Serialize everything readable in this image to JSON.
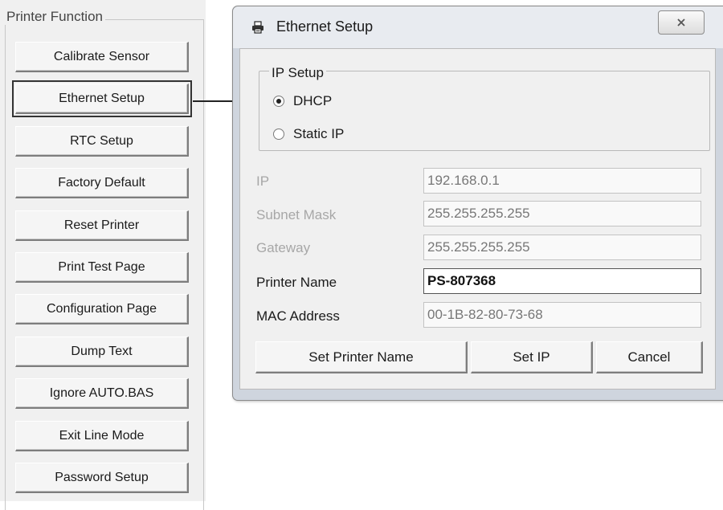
{
  "printer_function": {
    "title": "Printer Function",
    "buttons": [
      {
        "label": "Calibrate Sensor"
      },
      {
        "label": "Ethernet Setup"
      },
      {
        "label": "RTC Setup"
      },
      {
        "label": "Factory Default"
      },
      {
        "label": "Reset Printer"
      },
      {
        "label": "Print Test Page"
      },
      {
        "label": "Configuration Page"
      },
      {
        "label": "Dump Text"
      },
      {
        "label": "Ignore AUTO.BAS"
      },
      {
        "label": "Exit Line Mode"
      },
      {
        "label": "Password Setup"
      }
    ],
    "selected": "Ethernet Setup"
  },
  "dialog": {
    "title": "Ethernet Setup",
    "icon": "printer-icon",
    "close_icon": "close-icon",
    "ip_setup": {
      "title": "IP Setup",
      "options": [
        "DHCP",
        "Static IP"
      ],
      "selected": "DHCP"
    },
    "fields": {
      "ip": {
        "label": "IP",
        "value": "192.168.0.1"
      },
      "subnet": {
        "label": "Subnet Mask",
        "value": "255.255.255.255"
      },
      "gateway": {
        "label": "Gateway",
        "value": "255.255.255.255"
      },
      "printer_name": {
        "label": "Printer Name",
        "value": "PS-807368"
      },
      "mac": {
        "label": "MAC Address",
        "value": "00-1B-82-80-73-68"
      }
    },
    "buttons": {
      "set_name": "Set Printer Name",
      "set_ip": "Set IP",
      "cancel": "Cancel"
    }
  }
}
